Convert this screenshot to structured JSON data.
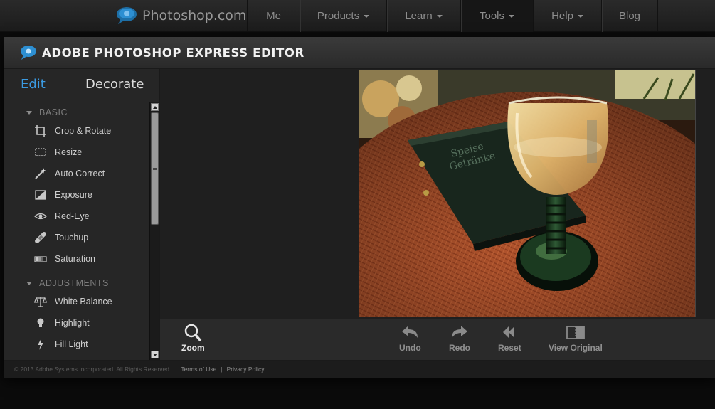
{
  "site": {
    "brand": "Photoshop.com",
    "nav": [
      {
        "label": "Me",
        "dropdown": false
      },
      {
        "label": "Products",
        "dropdown": true
      },
      {
        "label": "Learn",
        "dropdown": true
      },
      {
        "label": "Tools",
        "dropdown": true,
        "active": true
      },
      {
        "label": "Help",
        "dropdown": true
      },
      {
        "label": "Blog",
        "dropdown": false
      }
    ]
  },
  "editor": {
    "title": "ADOBE PHOTOSHOP EXPRESS EDITOR",
    "tabs": {
      "edit": "Edit",
      "decorate": "Decorate"
    },
    "sections": {
      "basic": {
        "heading": "BASIC",
        "tools": [
          "Crop & Rotate",
          "Resize",
          "Auto Correct",
          "Exposure",
          "Red-Eye",
          "Touchup",
          "Saturation"
        ]
      },
      "adjustments": {
        "heading": "ADJUSTMENTS",
        "tools": [
          "White Balance",
          "Highlight",
          "Fill Light"
        ]
      }
    },
    "bottom_toolbar": {
      "zoom": "Zoom",
      "undo": "Undo",
      "redo": "Redo",
      "reset": "Reset",
      "view_original": "View Original"
    },
    "footer": {
      "copyright": "© 2013 Adobe Systems Incorporated. All Rights Reserved.",
      "terms": "Terms of Use",
      "separator": "|",
      "privacy": "Privacy Policy"
    },
    "photo_texts": [
      "Speise",
      "Getränke"
    ]
  },
  "colors": {
    "accent_blue": "#3b9ae1",
    "brand_logo": "#1e8fd6"
  }
}
